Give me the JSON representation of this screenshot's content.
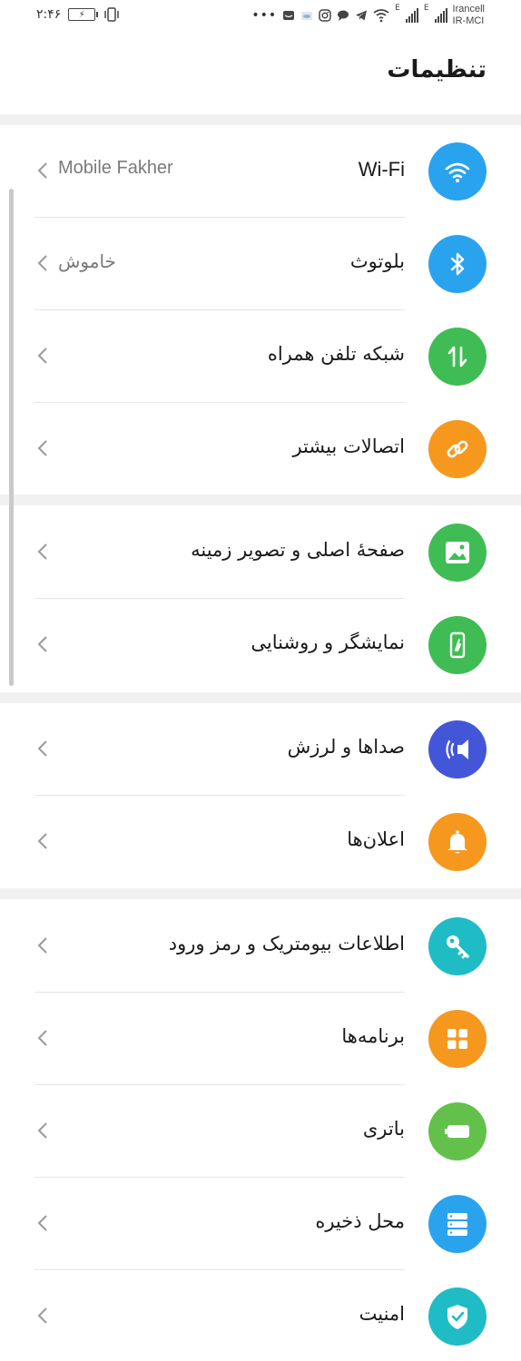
{
  "status_bar": {
    "time": "۲:۴۶",
    "carrier_1": "Irancell",
    "carrier_2": "IR-MCI",
    "network_1": "E",
    "network_2": "E",
    "icons": [
      "more-dots-icon",
      "message-icon",
      "cloud-icon",
      "instagram-icon",
      "chat-icon",
      "telegram-icon",
      "wifi-icon",
      "signal-icon",
      "signal-icon",
      "battery-icon",
      "vibrate-icon"
    ]
  },
  "header": {
    "title": "تنظیمات"
  },
  "settings": [
    {
      "id": "wifi",
      "label": "Wi-Fi",
      "value": "Mobile Fakher",
      "icon": "wifi-icon",
      "color": "#2aa3ef"
    },
    {
      "id": "bluetooth",
      "label": "بلوتوث",
      "value": "خاموش",
      "icon": "bluetooth-icon",
      "color": "#2aa3ef"
    },
    {
      "id": "mobile-network",
      "label": "شبکه تلفن همراه",
      "value": "",
      "icon": "mobile-data-icon",
      "color": "#3fbd54"
    },
    {
      "id": "more-connections",
      "label": "اتصالات بیشتر",
      "value": "",
      "icon": "link-icon",
      "color": "#f6981e"
    },
    {
      "id": "home-wallpaper",
      "label": "صفحهٔ اصلی و تصویر زمینه",
      "value": "",
      "icon": "image-icon",
      "color": "#3fbd54"
    },
    {
      "id": "display-brightness",
      "label": "نمایشگر و روشنایی",
      "value": "",
      "icon": "display-icon",
      "color": "#3fbd54"
    },
    {
      "id": "sounds-vibration",
      "label": "صداها و لرزش",
      "value": "",
      "icon": "speaker-icon",
      "color": "#4456d8"
    },
    {
      "id": "notifications",
      "label": "اعلان‌ها",
      "value": "",
      "icon": "bell-icon",
      "color": "#f6981e"
    },
    {
      "id": "biometrics",
      "label": "اطلاعات بیومتریک و رمز ورود",
      "value": "",
      "icon": "key-icon",
      "color": "#1fbcc6"
    },
    {
      "id": "apps",
      "label": "برنامه‌ها",
      "value": "",
      "icon": "apps-grid-icon",
      "color": "#f6981e"
    },
    {
      "id": "battery",
      "label": "باتری",
      "value": "",
      "icon": "battery-setting-icon",
      "color": "#63c14b"
    },
    {
      "id": "storage",
      "label": "محل ذخیره",
      "value": "",
      "icon": "storage-icon",
      "color": "#2aa3ef"
    },
    {
      "id": "security",
      "label": "امنیت",
      "value": "",
      "icon": "shield-check-icon",
      "color": "#1fbcc6"
    }
  ]
}
